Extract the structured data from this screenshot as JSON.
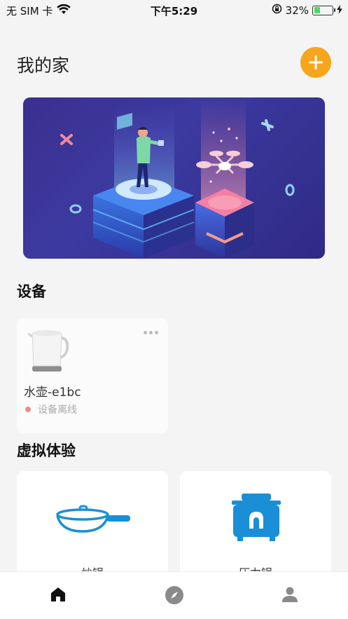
{
  "status_bar": {
    "carrier": "无 SIM 卡",
    "time": "下午5:29",
    "battery": "32%",
    "battery_level": 0.32
  },
  "header": {
    "title": "我的家",
    "add_icon": "plus-icon"
  },
  "banner": {
    "illustration": "person-with-drone-isometric"
  },
  "devices_section": {
    "title": "设备",
    "devices": [
      {
        "name": "水壶-e1bc",
        "status": "设备离线",
        "status_color": "#f08a8a",
        "icon": "kettle-icon"
      }
    ]
  },
  "virtual_section": {
    "title": "虚拟体验",
    "items": [
      {
        "label": "炒锅",
        "icon": "wok-icon"
      },
      {
        "label": "压力锅",
        "icon": "pressure-cooker-icon"
      }
    ]
  },
  "tab_bar": {
    "tabs": [
      {
        "name": "home",
        "icon": "home-icon",
        "active": true
      },
      {
        "name": "discover",
        "icon": "compass-icon",
        "active": false
      },
      {
        "name": "profile",
        "icon": "user-icon",
        "active": false
      }
    ]
  },
  "colors": {
    "accent": "#f7a51c",
    "device_blue": "#1a8fd8",
    "offline": "#f08a8a"
  }
}
